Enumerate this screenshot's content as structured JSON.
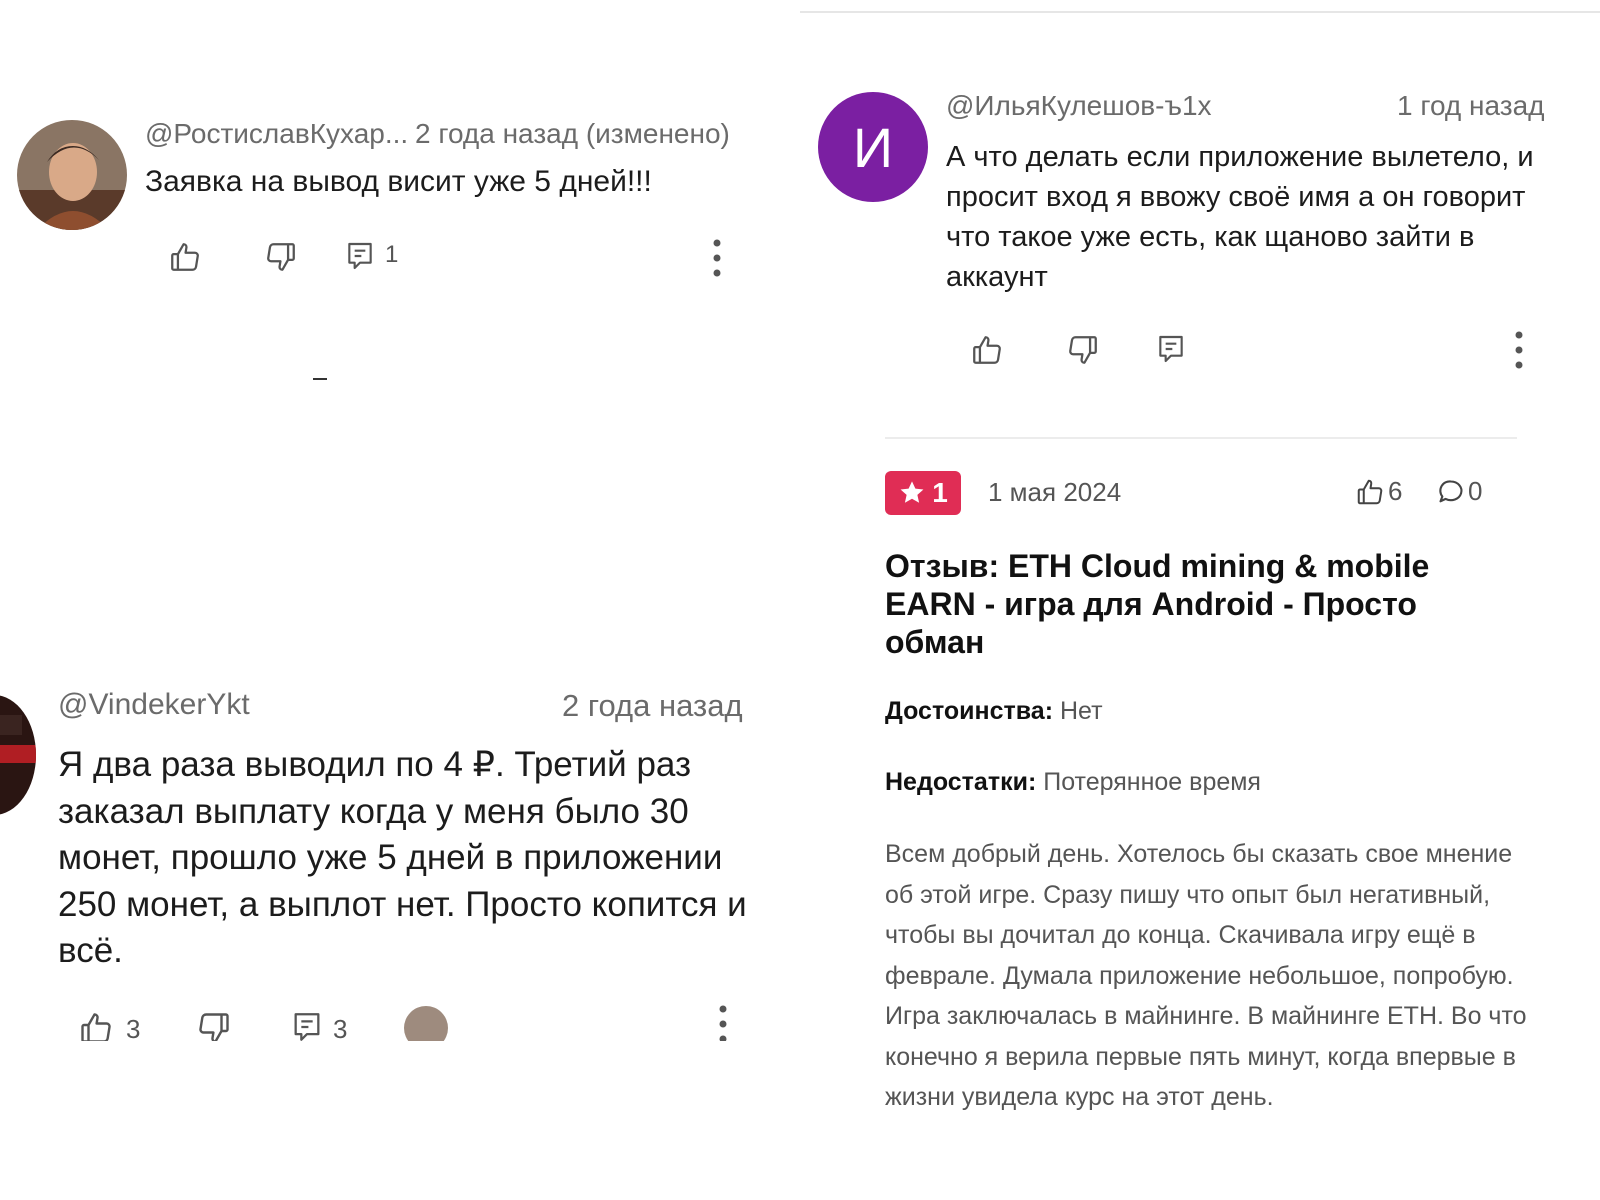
{
  "comment1": {
    "author": "@РостиславКухар...",
    "time": "2 года назад (изменено)",
    "text": "Заявка на вывод висит уже 5 дней!!!",
    "reply_count": "1"
  },
  "comment2": {
    "author": "@VindekerYkt",
    "time": "2 года назад",
    "text": "Я два раза выводил по 4 ₽. Третий раз заказал выплату когда у меня было 30 монет, прошло уже 5 дней в приложении 250 монет, а выплот нет. Просто копится и всё.",
    "like_count": "3",
    "reply_count": "3"
  },
  "comment3": {
    "avatar_letter": "И",
    "avatar_color": "#7b1fa2",
    "author": "@ИльяКулешов-ъ1х",
    "time": "1 год назад",
    "text": "А что делать если приложение вылетело, и просит вход я ввожу своё имя а он говорит что такое уже есть, как щаново зайти в аккаунт"
  },
  "review": {
    "rating": "1",
    "badge_color": "#e02d55",
    "date": "1 мая 2024",
    "likes": "6",
    "comments": "0",
    "title": "Отзыв: ETH Cloud mining & mobile EARN - игра для Android - Просто обман",
    "pros_label": "Достоинства:",
    "pros_value": "Нет",
    "cons_label": "Недостатки:",
    "cons_value": "Потерянное время",
    "body": "Всем добрый день. Хотелось бы сказать свое мнение об этой игре. Сразу пишу что опыт был негативный, чтобы вы дочитал до конца. Скачивала игру ещё в феврале. Думала приложение небольшое, попробую. Игра заключалась в майнинге. В майнинге ETH. Во что конечно я верила первые пять минут, когда впервые в жизни увидела курс на этот день."
  }
}
